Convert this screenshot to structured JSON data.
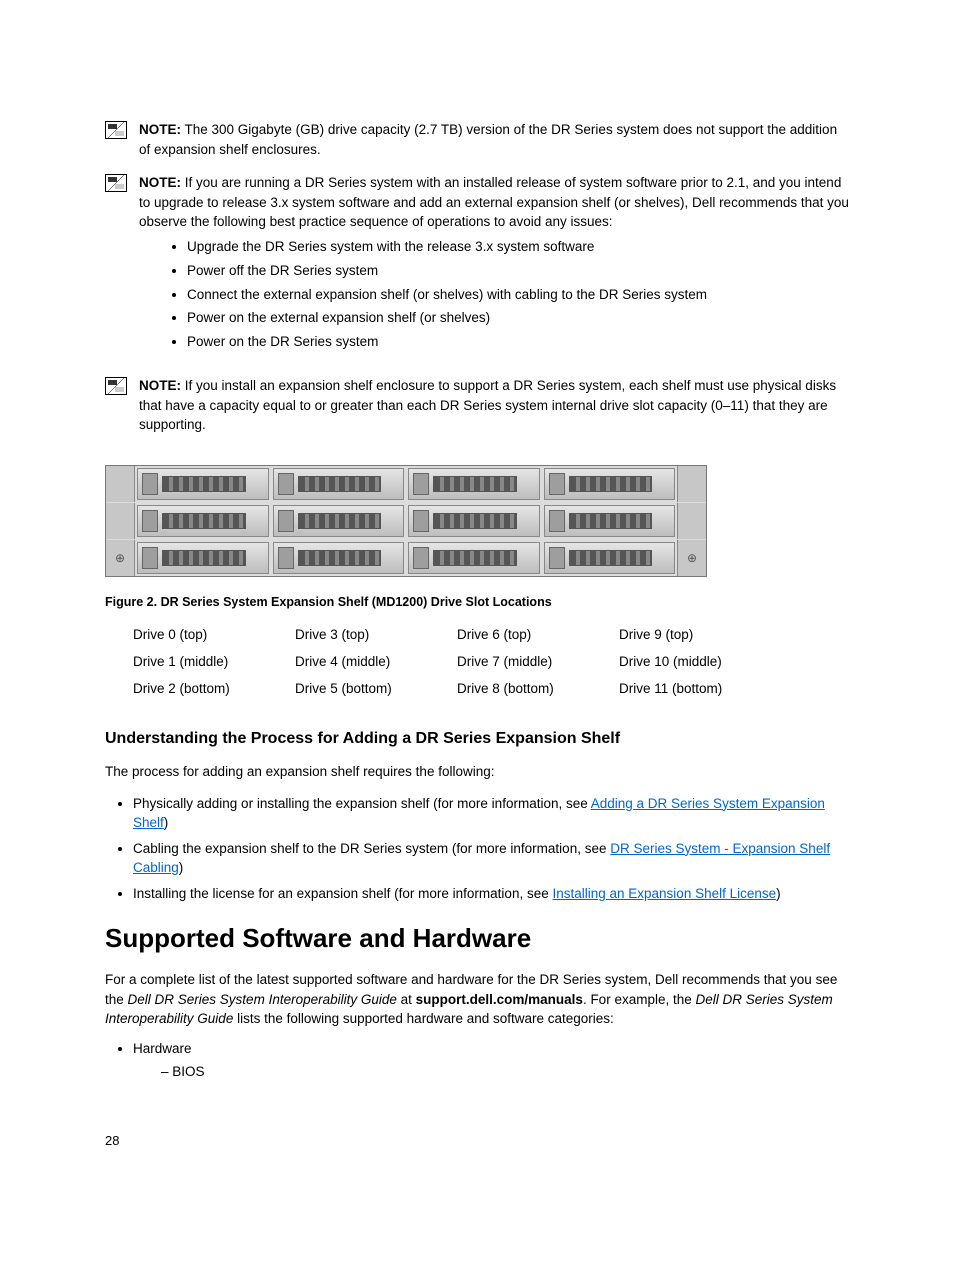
{
  "notes": {
    "label": "NOTE:",
    "n1": " The 300 Gigabyte (GB) drive capacity (2.7 TB) version of the DR Series system does not support the addition of expansion shelf enclosures.",
    "n2_intro": " If you are running a DR Series system with an installed release of system software prior to 2.1, and you intend to upgrade to release 3.x system software and add an external expansion shelf (or shelves), Dell recommends that you observe the following best practice sequence of operations to avoid any issues:",
    "n2_bullets": [
      "Upgrade the DR Series system with the release 3.x system software",
      "Power off the DR Series system",
      "Connect the external expansion shelf (or shelves) with cabling to the DR Series system",
      "Power on the external expansion shelf (or shelves)",
      "Power on the DR Series system"
    ],
    "n3": " If you install an expansion shelf enclosure to support a DR Series system, each shelf must use physical disks that have a capacity equal to or greater than each DR Series system internal drive slot capacity (0–11) that they are supporting."
  },
  "figure_caption": "Figure 2. DR Series System Expansion Shelf (MD1200) Drive Slot Locations",
  "drive_grid": [
    "Drive 0 (top)",
    "Drive 3 (top)",
    "Drive 6 (top)",
    "Drive 9 (top)",
    "Drive 1 (middle)",
    "Drive 4 (middle)",
    "Drive 7 (middle)",
    "Drive 10 (middle)",
    "Drive 2 (bottom)",
    "Drive 5 (bottom)",
    "Drive 8 (bottom)",
    "Drive 11 (bottom)"
  ],
  "subheading": "Understanding the Process for Adding a DR Series Expansion Shelf",
  "process_intro": "The process for adding an expansion shelf requires the following:",
  "process": {
    "p1_pre": "Physically adding or installing the expansion shelf (for more information, see ",
    "p1_link": "Adding a DR Series System Expansion Shelf",
    "p1_post": ")",
    "p2_pre": "Cabling the expansion shelf to the DR Series system (for more information, see ",
    "p2_link": "DR Series System - Expansion Shelf Cabling",
    "p2_post": ")",
    "p3_pre": "Installing the license for an expansion shelf (for more information, see ",
    "p3_link": "Installing an Expansion Shelf License",
    "p3_post": ")"
  },
  "heading": "Supported Software and Hardware",
  "sw_hw": {
    "para_pre": "For a complete list of the latest supported software and hardware for the DR Series system, Dell recommends that you see the ",
    "guide": "Dell DR Series System Interoperability Guide",
    "at": " at ",
    "url": "support.dell.com/manuals",
    "para_mid": ". For example, the ",
    "guide2": "Dell DR Series System Interoperability Guide",
    "para_post": " lists the following supported hardware and software categories:"
  },
  "hw_list": {
    "item1": "Hardware",
    "sub1": "BIOS"
  },
  "page_num": "28"
}
